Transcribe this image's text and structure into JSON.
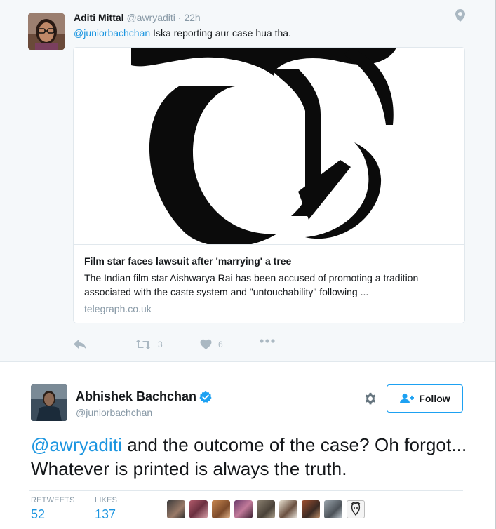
{
  "reply_tweet": {
    "author_name": "Aditi Mittal",
    "author_handle": "@awryaditi",
    "separator": "·",
    "time": "22h",
    "mention": "@juniorbachchan",
    "text": " Iska reporting aur case hua tha.",
    "card": {
      "title": "Film star faces lawsuit after 'marrying' a tree",
      "description": "The Indian film star Aishwarya Rai has been accused of promoting a tradition associated with the caste system and \"untouchability\" following ...",
      "domain": "telegraph.co.uk"
    },
    "actions": {
      "reply_icon": "reply-icon",
      "retweet_icon": "retweet-icon",
      "retweet_count": "3",
      "like_icon": "heart-icon",
      "like_count": "6",
      "more_icon": "more-icon"
    }
  },
  "main_tweet": {
    "author_name": "Abhishek Bachchan",
    "author_handle": "@juniorbachchan",
    "verified_icon": "verified-badge-icon",
    "gear_icon": "gear-icon",
    "follow_label": "Follow",
    "mention": "@awryaditi",
    "text": " and the outcome of the case? Oh forgot... Whatever is printed is always the truth.",
    "stats": {
      "retweets_label": "RETWEETS",
      "retweets_value": "52",
      "likes_label": "LIKES",
      "likes_value": "137"
    },
    "liker_avatar_count": 9
  },
  "colors": {
    "link": "#1b95e0",
    "muted": "#8899a6",
    "icon": "#aab8c2",
    "verified": "#1da1f2",
    "background_reply": "#f5f8fa"
  }
}
